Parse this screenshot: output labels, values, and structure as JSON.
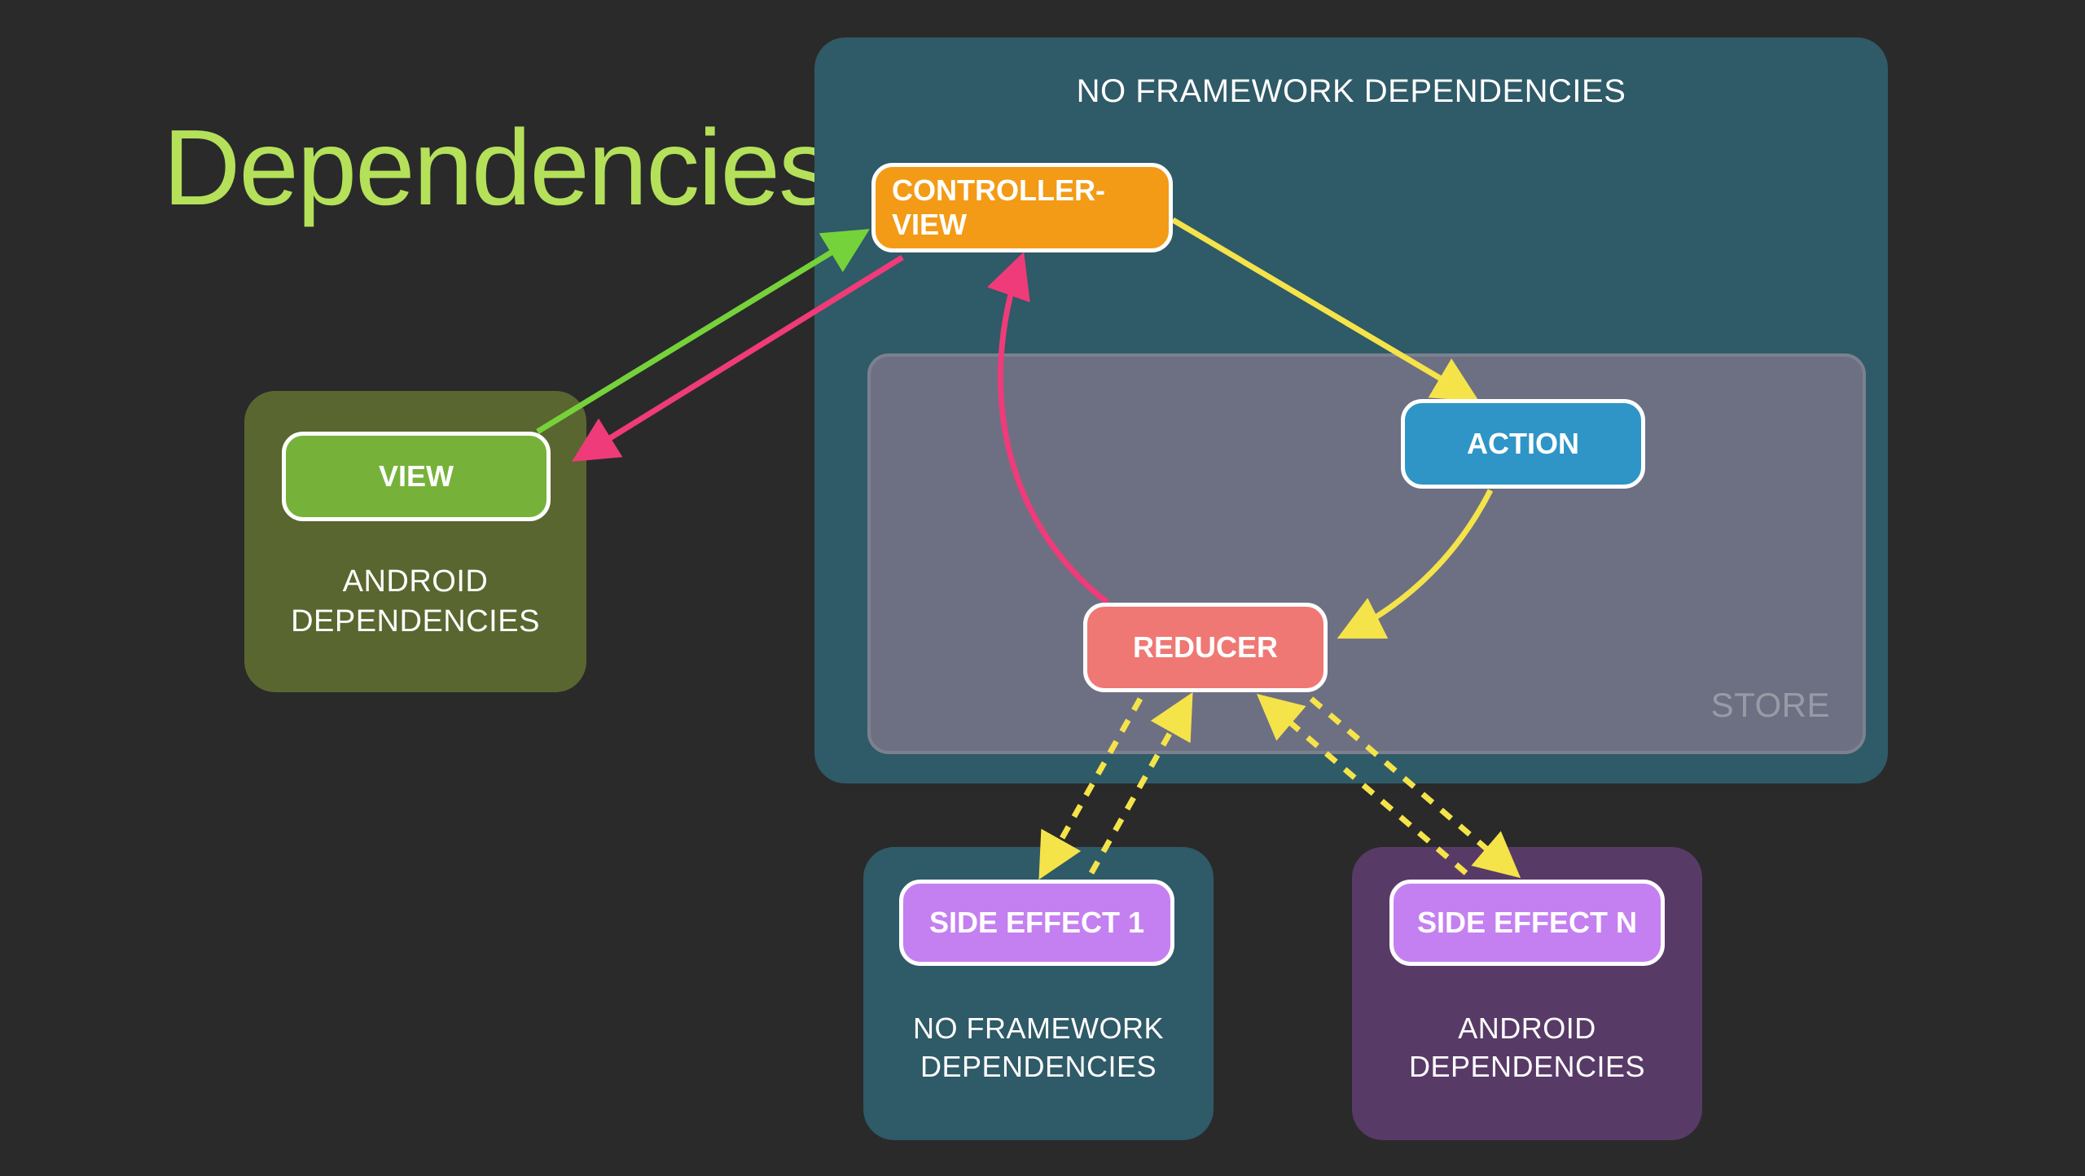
{
  "title": "Dependencies",
  "containers": {
    "no_framework": {
      "label": "NO FRAMEWORK DEPENDENCIES"
    },
    "store": {
      "label": "STORE"
    },
    "android_view": {
      "label_line1": "ANDROID",
      "label_line2": "DEPENDENCIES"
    },
    "side_effect_1_box": {
      "label_line1": "NO FRAMEWORK",
      "label_line2": "DEPENDENCIES"
    },
    "side_effect_n_box": {
      "label_line1": "ANDROID",
      "label_line2": "DEPENDENCIES"
    }
  },
  "nodes": {
    "view": "VIEW",
    "controller_view": "CONTROLLER-VIEW",
    "action": "ACTION",
    "reducer": "REDUCER",
    "side_effect_1": "SIDE EFFECT 1",
    "side_effect_n": "SIDE EFFECT N"
  },
  "colors": {
    "bg": "#2a2a2a",
    "title": "#b5e05a",
    "no_framework_box": "#2f5a67",
    "store_box": "#6d7082",
    "android_view_box": "#59662f",
    "side_effect_n_box": "#583a67",
    "node_view": "#76b23a",
    "node_controller_view": "#f39b16",
    "node_action": "#2e95c6",
    "node_reducer": "#ef7874",
    "node_side_effect": "#c480f0",
    "arrow_green": "#76d23a",
    "arrow_pink": "#ef3b79",
    "arrow_yellow": "#f5e34a"
  },
  "arrows": [
    {
      "from": "view",
      "to": "controller_view",
      "color": "green",
      "style": "solid"
    },
    {
      "from": "controller_view",
      "to": "view",
      "color": "pink",
      "style": "solid"
    },
    {
      "from": "controller_view",
      "to": "action",
      "color": "yellow",
      "style": "solid"
    },
    {
      "from": "action",
      "to": "reducer",
      "color": "yellow",
      "style": "solid"
    },
    {
      "from": "reducer",
      "to": "controller_view",
      "color": "pink",
      "style": "solid",
      "curved": true
    },
    {
      "from": "reducer",
      "to": "side_effect_1",
      "color": "yellow",
      "style": "dashed",
      "both": true
    },
    {
      "from": "reducer",
      "to": "side_effect_n",
      "color": "yellow",
      "style": "dashed",
      "both": true
    }
  ]
}
